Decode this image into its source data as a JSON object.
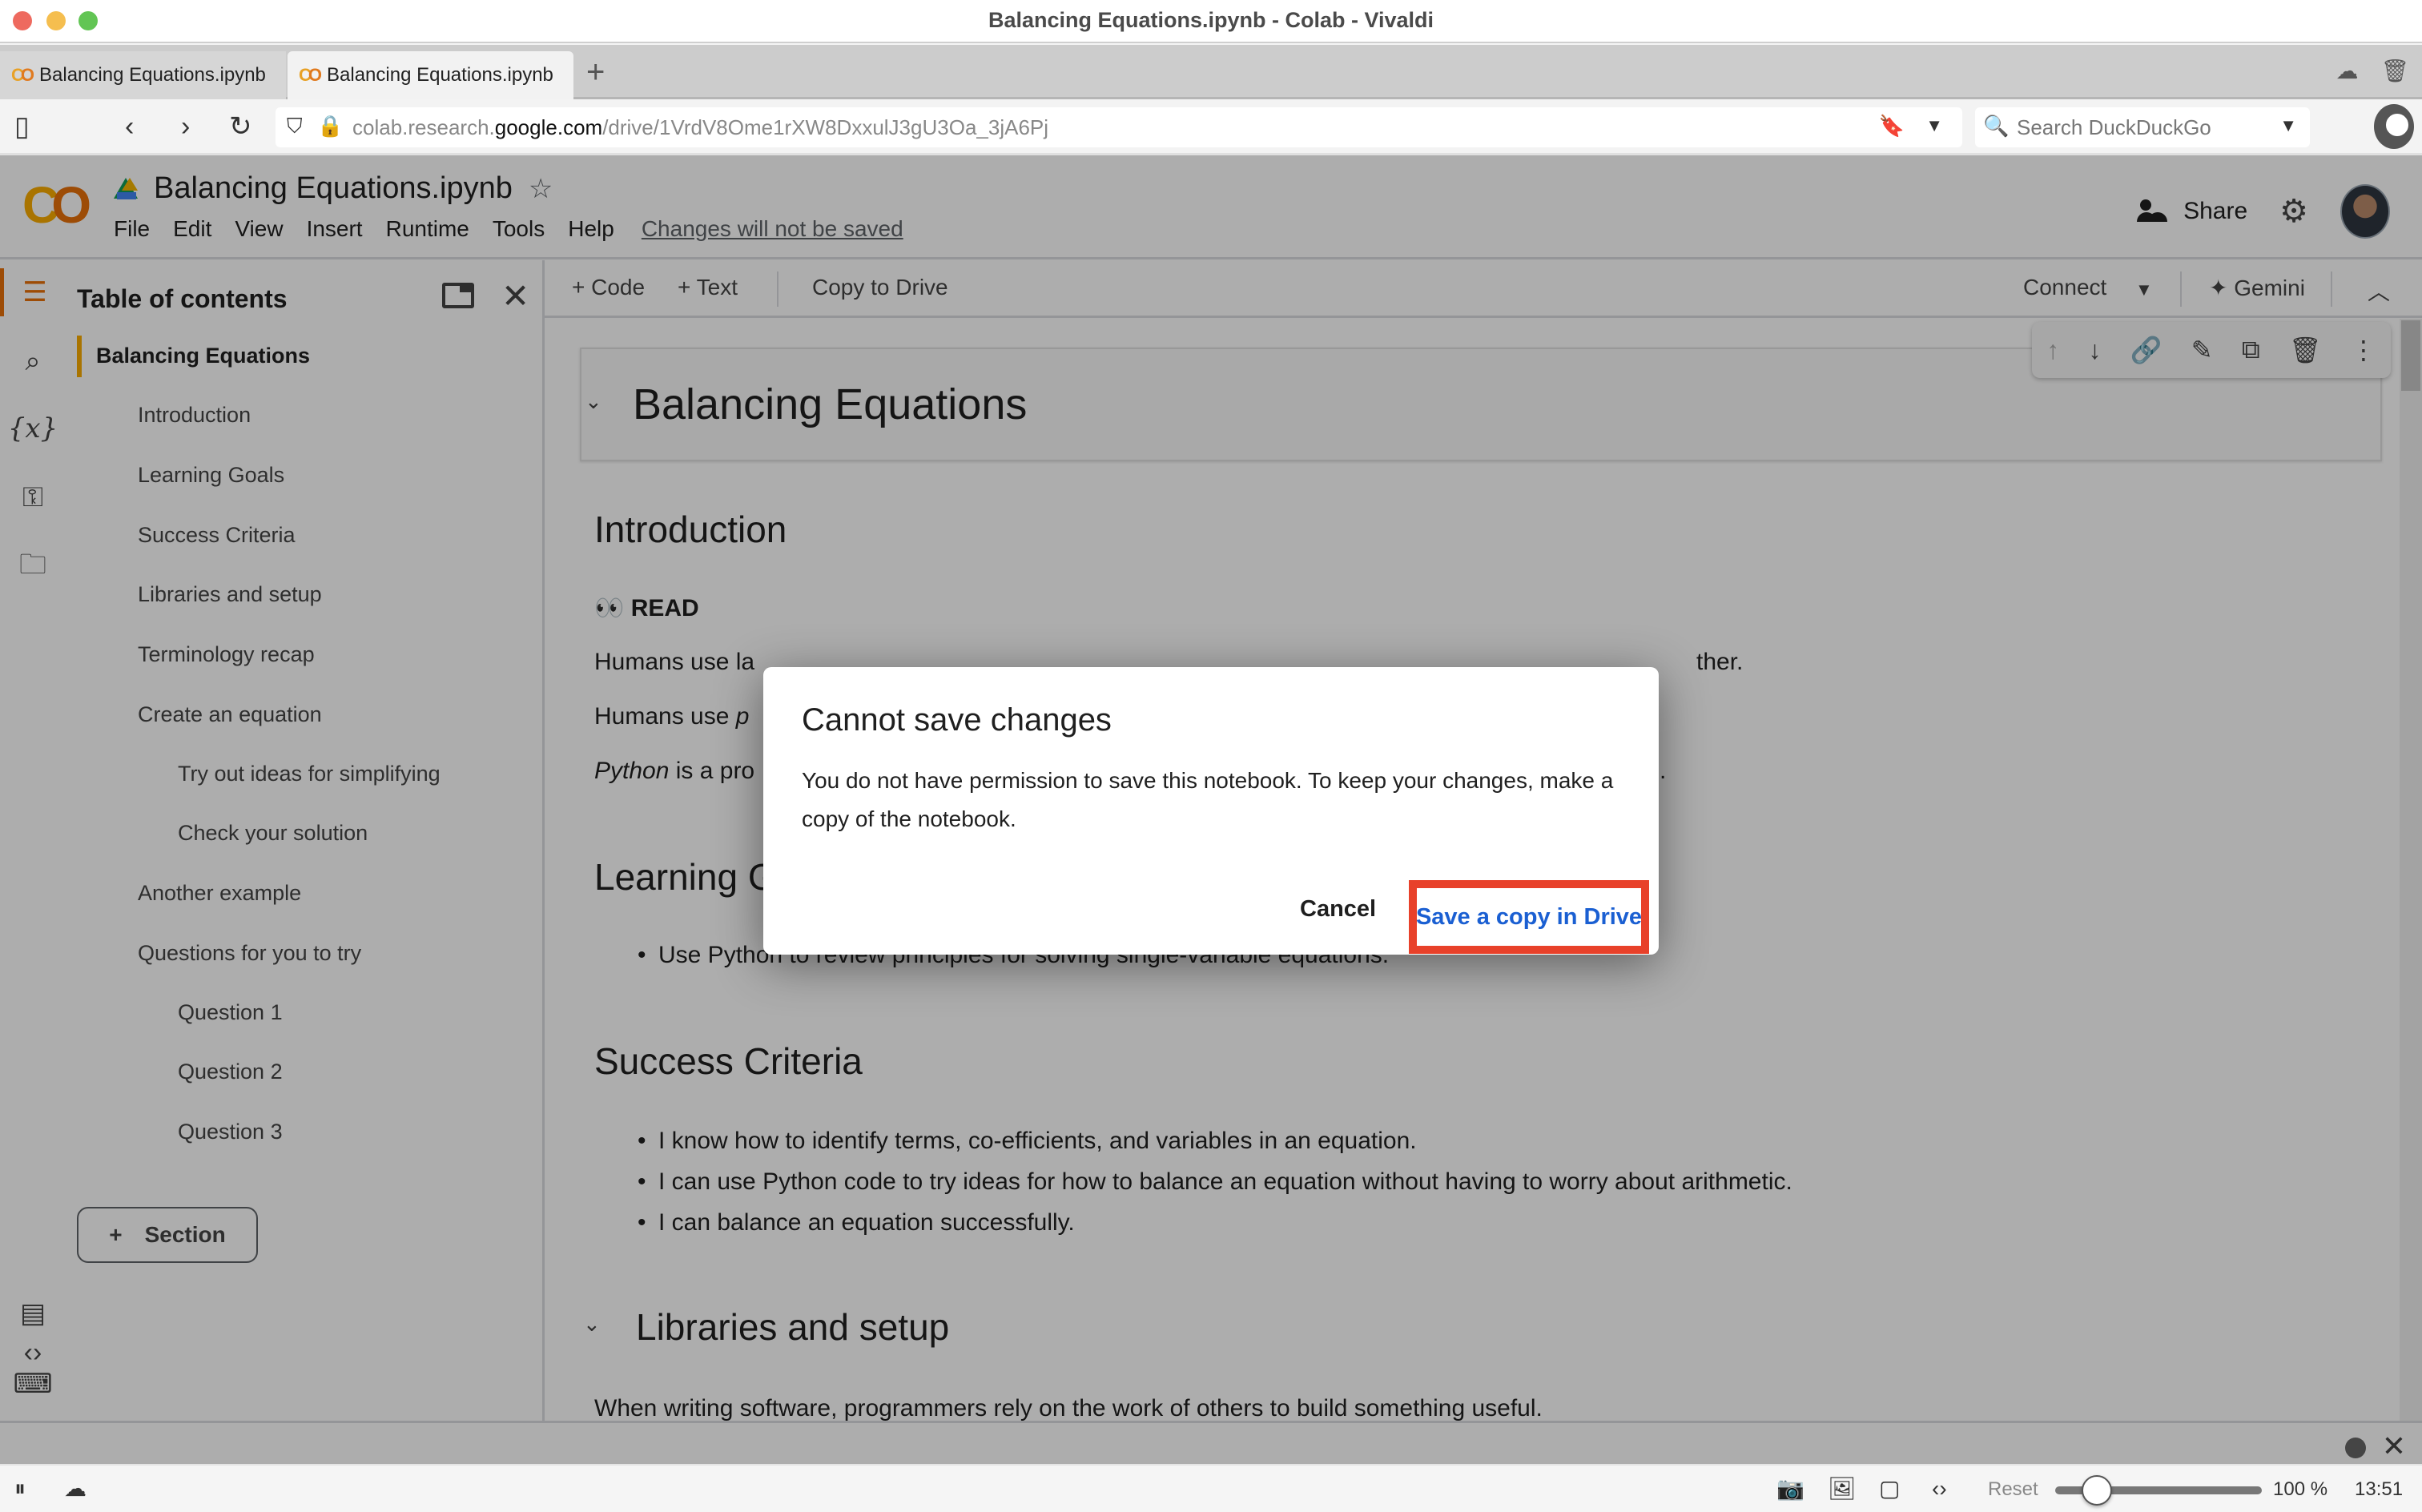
{
  "window": {
    "title": "Balancing Equations.ipynb - Colab - Vivaldi"
  },
  "tabs": [
    {
      "label": "Balancing Equations.ipynb",
      "active": false
    },
    {
      "label": "Balancing Equations.ipynb",
      "active": true
    }
  ],
  "tabbar": {
    "new_tab_icon": "plus-icon",
    "right_icons": [
      "cloud-icon",
      "trash-icon"
    ]
  },
  "addressbar": {
    "url_prefix": "colab.research.",
    "url_host": "google.com",
    "url_path": "/drive/1VrdV8Ome1rXW8DxxulJ3gU3Oa_3jA6Pj",
    "search_placeholder": "Search DuckDuckGo"
  },
  "colab": {
    "notebook_title": "Balancing Equations.ipynb",
    "menu": [
      "File",
      "Edit",
      "View",
      "Insert",
      "Runtime",
      "Tools",
      "Help"
    ],
    "unsaved_notice": "Changes will not be saved",
    "share_label": "Share",
    "toolbar": {
      "add_code": "Code",
      "add_text": "Text",
      "copy_to_drive": "Copy to Drive",
      "connect": "Connect",
      "gemini": "Gemini"
    }
  },
  "sidebar": {
    "rail_icons": [
      "toc-icon",
      "search-icon",
      "variables-icon",
      "key-icon",
      "folder-icon"
    ],
    "rail_bottom_icons": [
      "code-snippets-icon",
      "command-palette-icon",
      "terminal-icon"
    ],
    "toc_title": "Table of contents",
    "toc_items": [
      {
        "label": "Balancing Equations",
        "level": 1,
        "active": true
      },
      {
        "label": "Introduction",
        "level": 2
      },
      {
        "label": "Learning Goals",
        "level": 2
      },
      {
        "label": "Success Criteria",
        "level": 2
      },
      {
        "label": "Libraries and setup",
        "level": 2
      },
      {
        "label": "Terminology recap",
        "level": 2
      },
      {
        "label": "Create an equation",
        "level": 2
      },
      {
        "label": "Try out ideas for simplifying",
        "level": 3
      },
      {
        "label": "Check your solution",
        "level": 3
      },
      {
        "label": "Another example",
        "level": 2
      },
      {
        "label": "Questions for you to try",
        "level": 2
      },
      {
        "label": "Question 1",
        "level": 3
      },
      {
        "label": "Question 2",
        "level": 3
      },
      {
        "label": "Question 3",
        "level": 3
      }
    ],
    "section_button": "Section"
  },
  "notebook": {
    "title_heading": "Balancing Equations",
    "intro_heading": "Introduction",
    "read_label": "READ",
    "read_emoji": "👀",
    "intro_lines": [
      {
        "pre": "Humans use la",
        "em": "",
        "post": ""
      },
      {
        "pre": "Humans use ",
        "em": "p",
        "post": ""
      },
      {
        "pre": "",
        "em": "Python",
        "post": " is a pro"
      }
    ],
    "intro_line1_tail": "ther.",
    "intro_line3_tail": ".",
    "learning_heading_visible": "Learning G",
    "learning_goals": [
      "Use Python to review principles for solving single-variable equations."
    ],
    "success_heading": "Success Criteria",
    "success_criteria": [
      "I know how to identify terms, co-efficients, and variables in an equation.",
      "I can use Python code to try ideas for how to balance an equation without having to worry about arithmetic.",
      "I can balance an equation successfully."
    ],
    "libraries_heading": "Libraries and setup",
    "libraries_text": "When writing software, programmers rely on the work of others to build something useful."
  },
  "dialog": {
    "title": "Cannot save changes",
    "body": "You do not have permission to save this notebook. To keep your changes, make a copy of the notebook.",
    "cancel_label": "Cancel",
    "save_label": "Save a copy in Drive",
    "highlight_color": "#e8412a",
    "save_color": "#1a5fd2"
  },
  "statusbar": {
    "reset_label": "Reset",
    "zoom_level": "100 %",
    "zoom_fraction": 0.2,
    "time": "13:51"
  }
}
